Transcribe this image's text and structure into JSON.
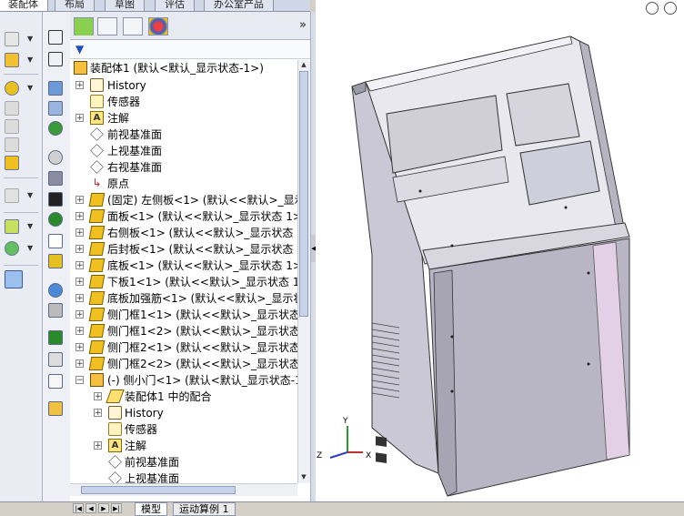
{
  "top_tabs": [
    "装配体",
    "布局",
    "草图",
    "评估",
    "办公室产品"
  ],
  "tree": {
    "root": "装配体1 (默认<默认_显示状态-1>)",
    "items": [
      "History",
      "传感器",
      "注解",
      "前视基准面",
      "上视基准面",
      "右视基准面",
      "原点",
      "(固定) 左侧板<1> (默认<<默认>_显示",
      "面板<1> (默认<<默认>_显示状态 1>)",
      "右侧板<1> (默认<<默认>_显示状态 1",
      "后封板<1> (默认<<默认>_显示状态 1",
      "底板<1> (默认<<默认>_显示状态 1>)",
      "下板1<1> (默认<<默认>_显示状态 1>",
      "底板加强筋<1> (默认<<默认>_显示状",
      "侧门框1<1> (默认<<默认>_显示状态",
      "侧门框1<2> (默认<<默认>_显示状态",
      "侧门框2<1> (默认<<默认>_显示状态",
      "侧门框2<2> (默认<<默认>_显示状态",
      "(-) 侧小门<1> (默认<默认_显示状态-1",
      "装配体1 中的配合",
      "History",
      "传感器",
      "注解",
      "前视基准面",
      "上视基准面"
    ]
  },
  "axes": {
    "x": "X",
    "y": "Y",
    "z": "Z"
  },
  "bottom_tabs": [
    "模型",
    "运动算例 1"
  ],
  "icons": {
    "filter": "filter-icon",
    "collapse": "double-chevron-right-icon",
    "zoom": "zoom-to-fit-icon"
  },
  "colors": {
    "selection_blue": "#2050c0",
    "part_yellow": "#f0c020",
    "cabinet_gray": "#b8b6c4",
    "door_pink": "#e4d0e6"
  }
}
